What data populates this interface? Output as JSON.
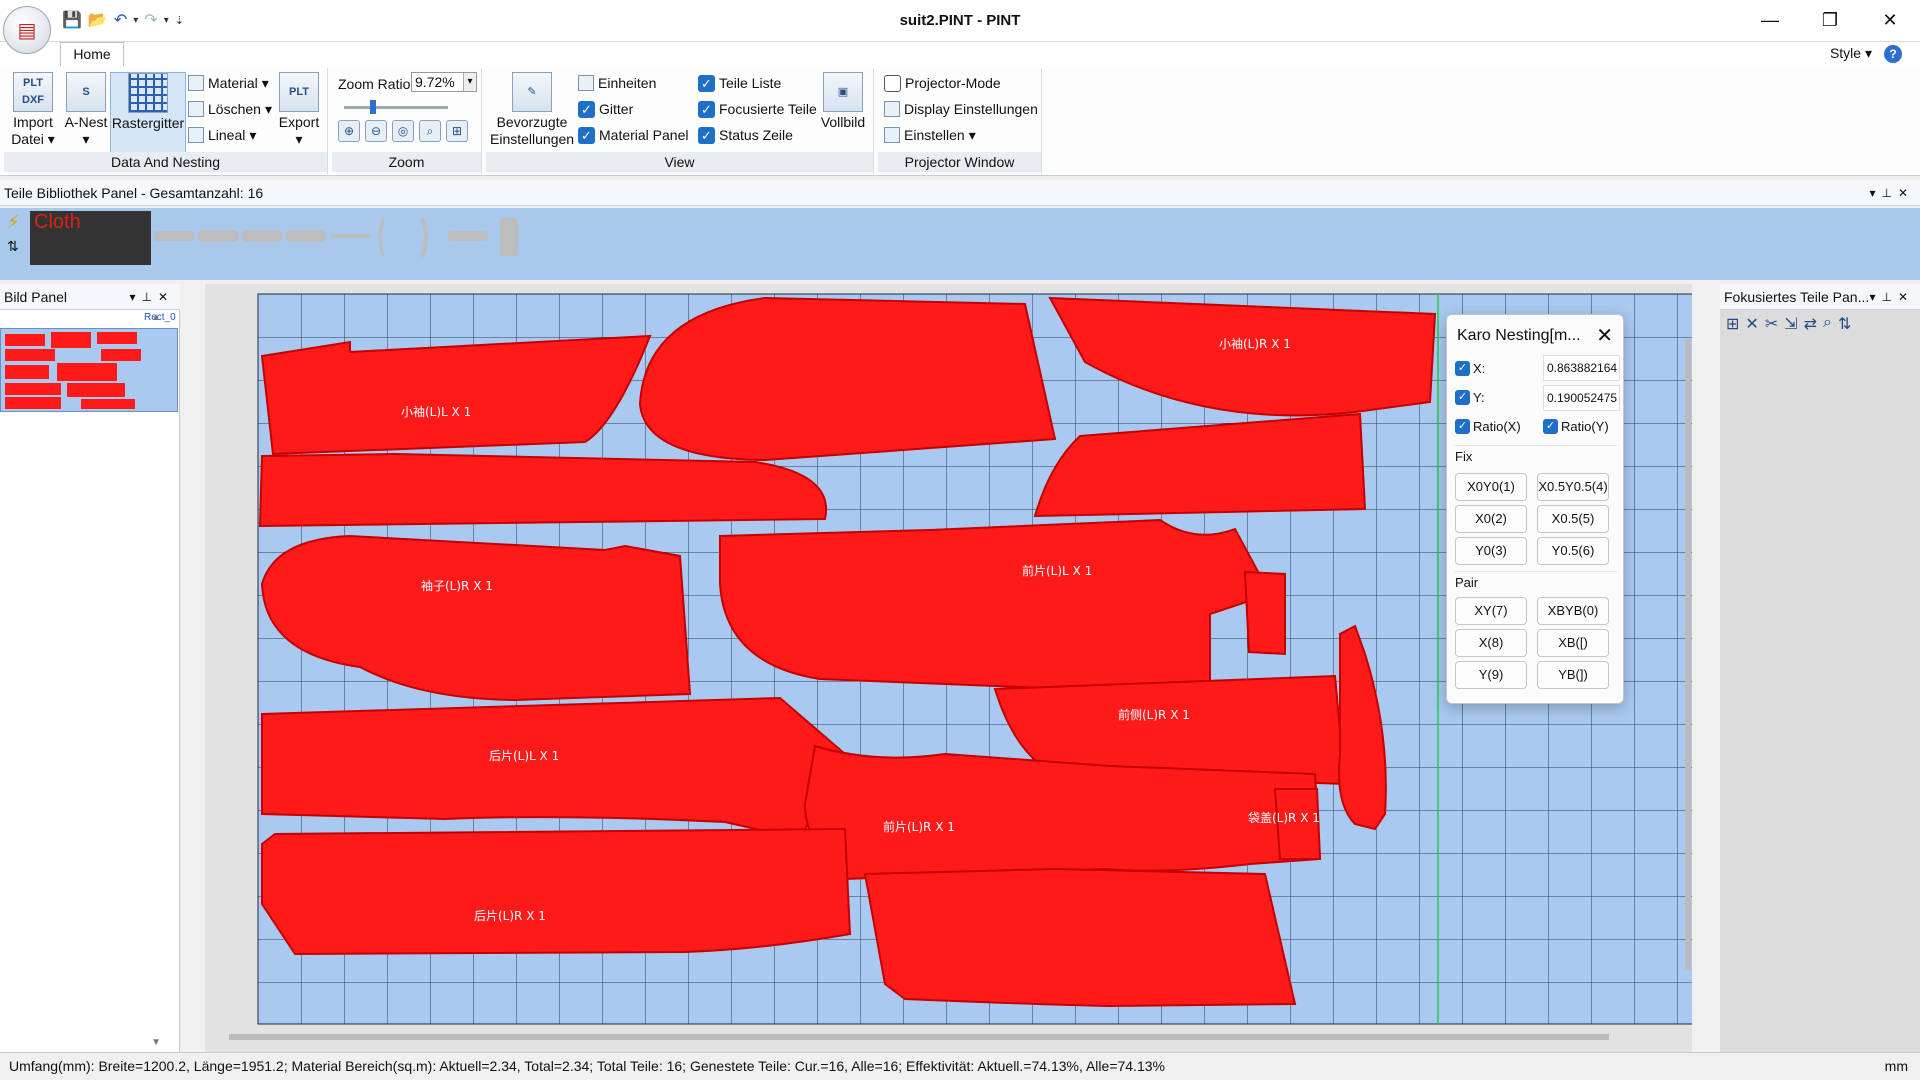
{
  "window": {
    "title": "suit2.PINT - PINT"
  },
  "tabs": {
    "home": "Home",
    "style": "Style"
  },
  "ribbon": {
    "data_nesting": {
      "label": "Data And Nesting",
      "import_line1": "Import",
      "import_line2": "Datei",
      "anest": "A-Nest",
      "rastergitter": "Rastergitter",
      "material": "Material",
      "loeschen": "Löschen",
      "lineal": "Lineal",
      "export": "Export",
      "plt_dxf": "PLT DXF",
      "plt": "PLT"
    },
    "zoom": {
      "label": "Zoom",
      "ratio_label": "Zoom Ratio",
      "ratio_value": "9.72%"
    },
    "view": {
      "label": "View",
      "bevorzugte_line1": "Bevorzugte",
      "bevorzugte_line2": "Einstellungen",
      "einheiten": "Einheiten",
      "gitter": "Gitter",
      "material_panel": "Material Panel",
      "teile_liste": "Teile Liste",
      "focusierte_teile": "Focusierte Teile",
      "status_zeile": "Status Zeile",
      "vollbild": "Vollbild"
    },
    "projector": {
      "label": "Projector Window",
      "mode": "Projector-Mode",
      "display": "Display Einstellungen",
      "einstellen": "Einstellen"
    }
  },
  "library": {
    "header": "Teile Bibliothek Panel - Gesamtanzahl: 16",
    "cloth_label": "Cloth"
  },
  "bild_panel": {
    "header": "Bild Panel",
    "thumb_label": "Rect_0"
  },
  "focus_panel": {
    "header": "Fokusiertes Teile Pan..."
  },
  "pieces": [
    {
      "label": "小袖(L)L X 1"
    },
    {
      "label": "袖子(L)R X 1"
    },
    {
      "label": "小袖(L)R X 1"
    },
    {
      "label": "前片(L)L X 1"
    },
    {
      "label": "后片(L)L X 1"
    },
    {
      "label": "前片(L)R X 1"
    },
    {
      "label": "后片(L)R X 1"
    },
    {
      "label": "前侧(L)R X 1"
    },
    {
      "label": "袋盖(L)R X 1"
    }
  ],
  "dialog": {
    "title": "Karo Nesting[m...",
    "x_label": "X:",
    "x_value": "0.863882164",
    "y_label": "Y:",
    "y_value": "0.190052475",
    "ratio_x": "Ratio(X)",
    "ratio_y": "Ratio(Y)",
    "fix_label": "Fix",
    "fix_buttons": [
      "X0Y0(1)",
      "X0.5Y0.5(4)",
      "X0(2)",
      "X0.5(5)",
      "Y0(3)",
      "Y0.5(6)"
    ],
    "pair_label": "Pair",
    "pair_buttons": [
      "XY(7)",
      "XBYB(0)",
      "X(8)",
      "XB([)",
      "Y(9)",
      "YB(])"
    ]
  },
  "status": {
    "text": "Umfang(mm): Breite=1200.2, Länge=1951.2; Material Bereich(sq.m): Aktuell=2.34, Total=2.34; Total Teile: 16; Genestete Teile: Cur.=16, Alle=16; Effektivität: Aktuell.=74.13%, Alle=74.13%",
    "unit": "mm"
  },
  "colors": {
    "piece": "#ff1a1a",
    "canvas": "#a9c9f0",
    "accent": "#1e6fc8"
  }
}
